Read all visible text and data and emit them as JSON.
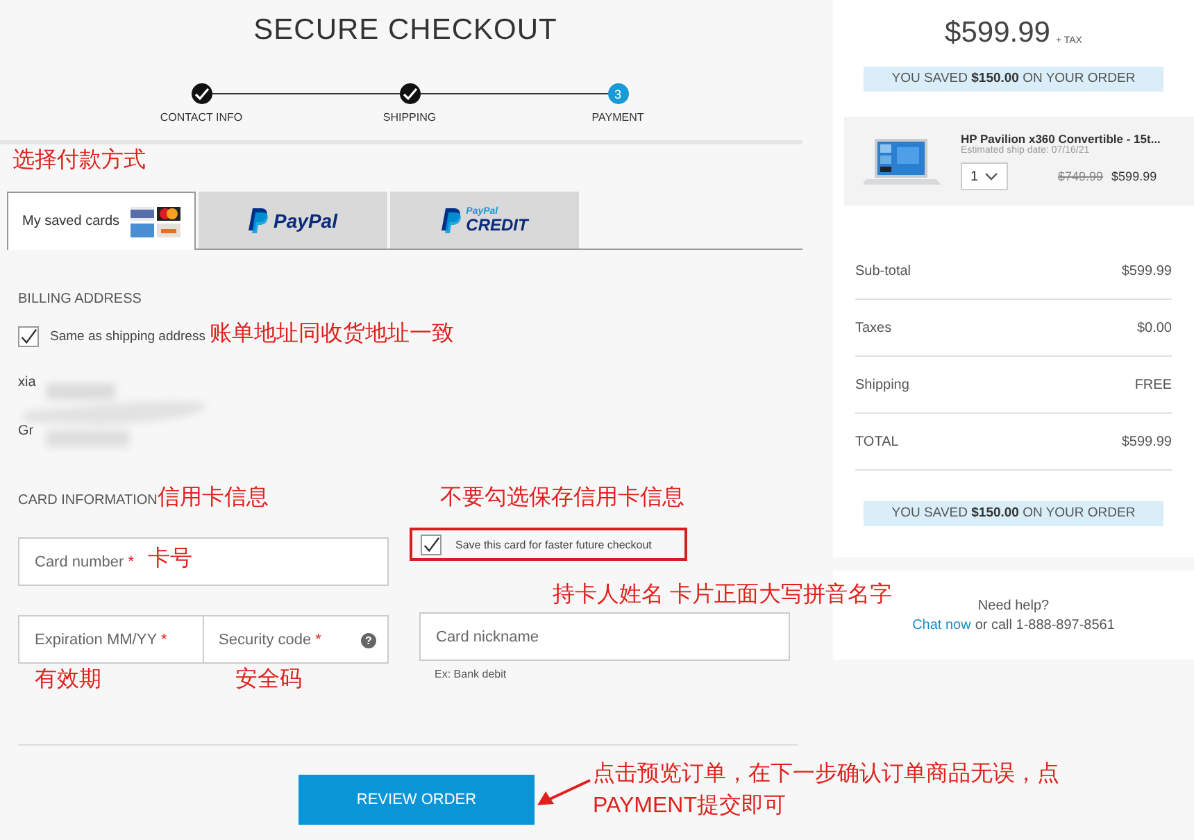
{
  "title": "SECURE CHECKOUT",
  "steps": [
    {
      "label": "CONTACT INFO",
      "done": true
    },
    {
      "label": "SHIPPING",
      "done": true
    },
    {
      "label": "PAYMENT",
      "done": false,
      "number": "3"
    }
  ],
  "payment_methods": {
    "annotation": "选择付款方式",
    "tabs": [
      {
        "kind": "saved_cards",
        "label": "My saved cards",
        "selected": true
      },
      {
        "kind": "paypal",
        "logo": "PayPal",
        "selected": false
      },
      {
        "kind": "paypal_credit",
        "logo_top": "PayPal",
        "logo_bottom": "CREDIT",
        "selected": false
      }
    ]
  },
  "billing": {
    "heading": "BILLING ADDRESS",
    "same_as_shipping": {
      "label": "Same as shipping address",
      "checked": true,
      "annotation": "账单地址同收货地址一致"
    },
    "address_lines": [
      "xia",
      "Gr"
    ]
  },
  "card_info": {
    "heading": "CARD INFORMATION",
    "annotation": "信用卡信息",
    "card_number": {
      "placeholder": "Card number",
      "required_mark": "*",
      "annotation": "卡号"
    },
    "save_card": {
      "label": "Save this card for faster future checkout",
      "checked": true,
      "annotation": "不要勾选保存信用卡信息"
    },
    "expiration": {
      "placeholder": "Expiration MM/YY",
      "required_mark": "*",
      "annotation": "有效期"
    },
    "security_code": {
      "placeholder": "Security code",
      "required_mark": "*",
      "help": "?",
      "annotation": "安全码"
    },
    "nickname": {
      "placeholder": "Card nickname",
      "hint": "Ex: Bank debit",
      "annotation": "持卡人姓名 卡片正面大写拼音名字"
    }
  },
  "review_button": {
    "label": "REVIEW ORDER",
    "annotation_lines": [
      "点击预览订单，在下一步确认订单商品无误，点",
      "PAYMENT提交即可"
    ]
  },
  "summary": {
    "price": "$599.99",
    "tax_note": "+ TAX",
    "savings": "YOU SAVED **$150.00** ON YOUR ORDER",
    "product": {
      "name": "HP Pavilion x360 Convertible - 15t...",
      "ship_date": "Estimated ship date: 07/16/21",
      "quantity": "1",
      "old_price": "$749.99",
      "price": "$599.99"
    },
    "rows": [
      {
        "label": "Sub-total",
        "value": "$599.99"
      },
      {
        "label": "Taxes",
        "value": "$0.00"
      },
      {
        "label": "Shipping",
        "value": "FREE"
      },
      {
        "label": "TOTAL",
        "value": "$599.99"
      }
    ],
    "savings_bottom": "YOU SAVED **$150.00** ON YOUR ORDER",
    "help": {
      "question": "Need help?",
      "link": "Chat now",
      "call": "or call 1-888-897-8561"
    }
  }
}
